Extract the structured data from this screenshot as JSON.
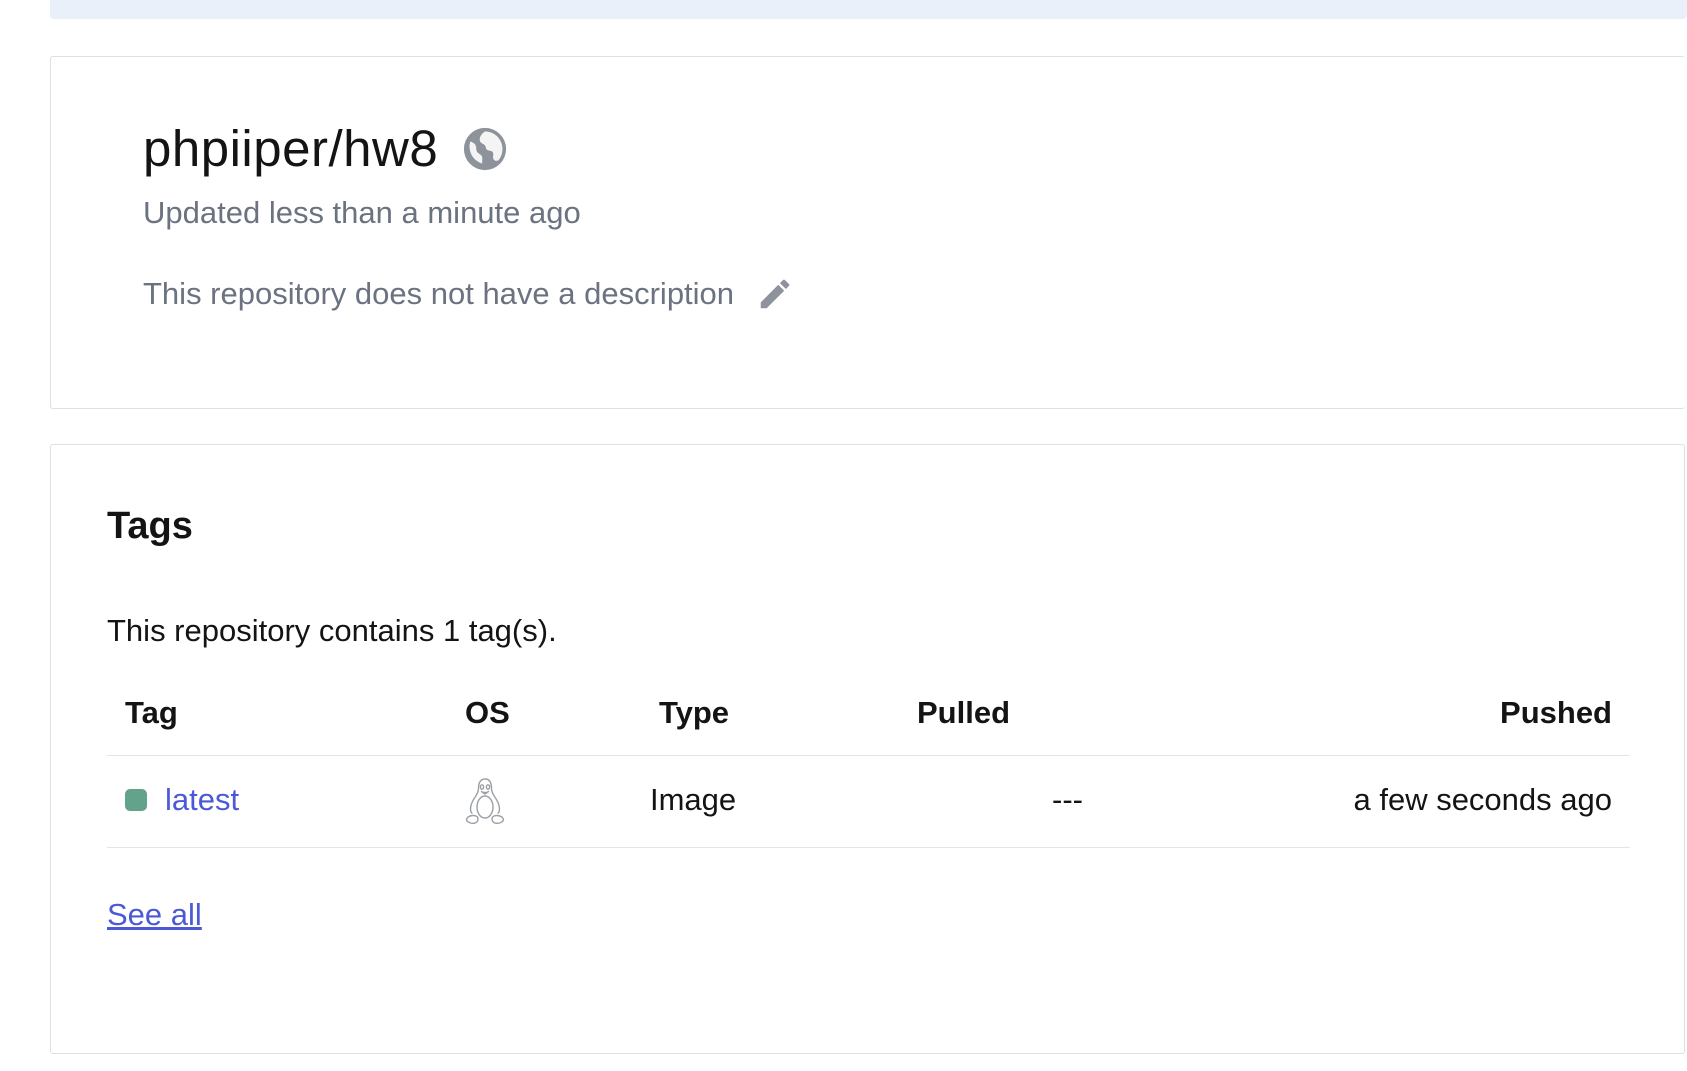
{
  "repo": {
    "name": "phpiiper/hw8",
    "visibility_icon": "globe-icon",
    "updated": "Updated less than a minute ago",
    "description": "This repository does not have a description",
    "edit_icon": "pencil-icon"
  },
  "tags": {
    "title": "Tags",
    "count_text": "This repository contains 1 tag(s).",
    "columns": {
      "tag": "Tag",
      "os": "OS",
      "type": "Type",
      "pulled": "Pulled",
      "pushed": "Pushed"
    },
    "rows": [
      {
        "tag": "latest",
        "os_icon": "linux-icon",
        "type": "Image",
        "pulled": "---",
        "pushed": "a few seconds ago",
        "status_color": "#64a38b"
      }
    ],
    "see_all": "See all"
  },
  "colors": {
    "link": "#4b59d6",
    "muted_text": "#6b7280",
    "banner": "#e9f0f9"
  }
}
